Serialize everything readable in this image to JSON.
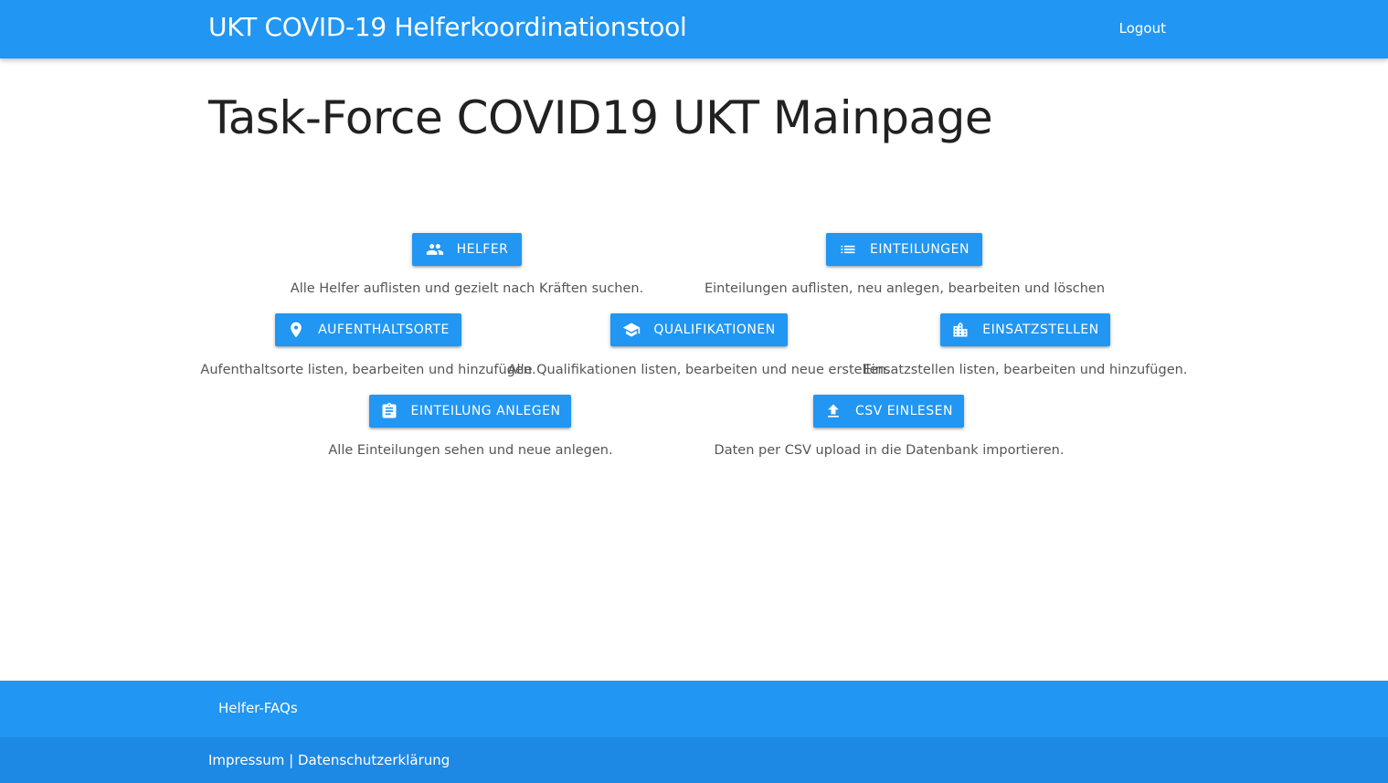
{
  "header": {
    "brand": "UKT COVID-19 Helferkoordinationstool",
    "logout": "Logout"
  },
  "main": {
    "title": "Task-Force COVID19 UKT Mainpage",
    "cards": [
      {
        "label": "Helfer",
        "icon": "people-icon",
        "description": "Alle Helfer auflisten und gezielt nach Kräften suchen."
      },
      {
        "label": "Einteilungen",
        "icon": "list-icon",
        "description": "Einteilungen auflisten, neu anlegen, bearbeiten und löschen"
      },
      {
        "label": "Aufenthaltsorte",
        "icon": "place-icon",
        "description": "Aufenthaltsorte listen, bearbeiten und hinzufügen."
      },
      {
        "label": "Qualifikationen",
        "icon": "school-icon",
        "description": "Alle Qualifikationen listen, bearbeiten und neue erstellen."
      },
      {
        "label": "Einsatzstellen",
        "icon": "location-city-icon",
        "description": "Einsatzstellen listen, bearbeiten und hinzufügen."
      },
      {
        "label": "Einteilung anlegen",
        "icon": "assignment-icon",
        "description": "Alle Einteilungen sehen und neue anlegen."
      },
      {
        "label": "CSV einlesen",
        "icon": "upload-icon",
        "description": "Daten per CSV upload in die Datenbank importieren."
      }
    ]
  },
  "footer": {
    "faq": "Helfer-FAQs",
    "impressum": "Impressum",
    "separator": " | ",
    "privacy": "Datenschutzerklärung"
  },
  "colors": {
    "primary": "#2196f3",
    "footer_dark": "#1e88e5"
  }
}
